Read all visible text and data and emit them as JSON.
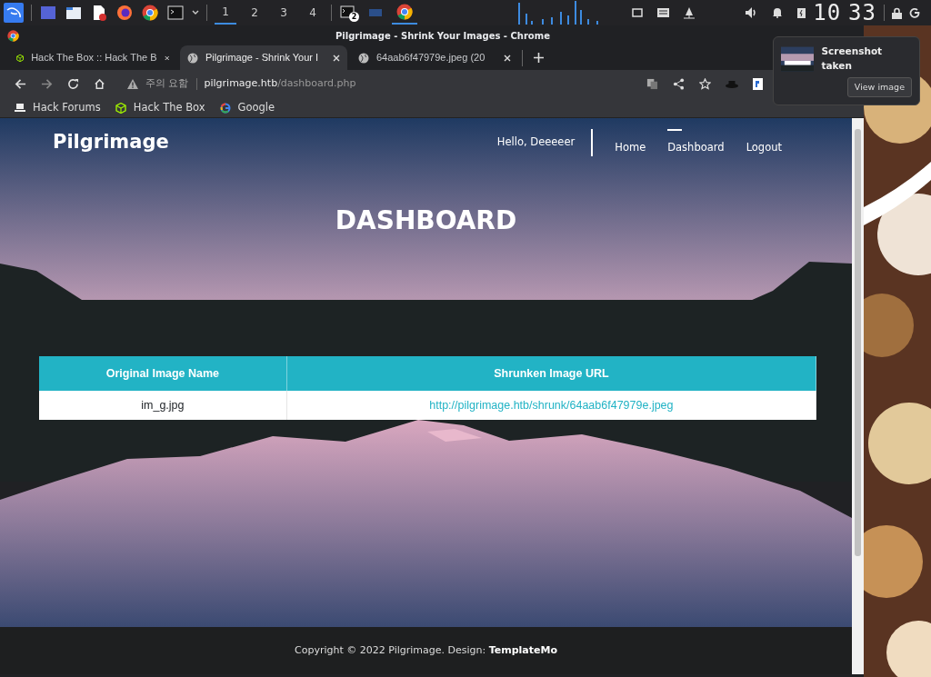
{
  "taskbar": {
    "workspaces": [
      {
        "label": "1",
        "selected": true
      },
      {
        "label": "2",
        "selected": false
      },
      {
        "label": "3",
        "selected": false
      },
      {
        "label": "4",
        "selected": false
      }
    ],
    "terminal_badge": "2",
    "clock": {
      "hours": "10",
      "minutes": "33"
    }
  },
  "window": {
    "title": "Pilgrimage - Shrink Your Images - Chrome"
  },
  "tabs": [
    {
      "label": "Hack The Box :: Hack The B",
      "kind": "htb",
      "selected": false
    },
    {
      "label": "Pilgrimage - Shrink Your I",
      "kind": "globe",
      "selected": true
    },
    {
      "label": "64aab6f47979e.jpeg (20",
      "kind": "globe",
      "selected": false
    }
  ],
  "address_bar": {
    "security_label": "주의 요함",
    "host": "pilgrimage.htb",
    "path": "/dashboard.php"
  },
  "bookmarks": [
    {
      "label": "Hack Forums",
      "kind": "laptop"
    },
    {
      "label": "Hack The Box",
      "kind": "htb"
    },
    {
      "label": "Google",
      "kind": "google"
    }
  ],
  "notification": {
    "title": "Screenshot taken",
    "button": "View image"
  },
  "page": {
    "brand": "Pilgrimage",
    "greeting": "Hello, Deeeeer",
    "nav": [
      {
        "label": "Home",
        "kind": "link",
        "selected": false
      },
      {
        "label": "Dashboard",
        "kind": "link",
        "selected": true
      },
      {
        "label": "Logout",
        "kind": "link",
        "selected": false
      }
    ],
    "heading": "DASHBOARD",
    "table": {
      "columns": [
        "Original Image Name",
        "Shrunken Image URL"
      ],
      "rows": [
        [
          "im_g.jpg",
          "http://pilgrimage.htb/shrunk/64aab6f47979e.jpeg"
        ]
      ]
    },
    "footer": "Copyright © 2022 Pilgrimage. Design: **TemplateMo**"
  }
}
